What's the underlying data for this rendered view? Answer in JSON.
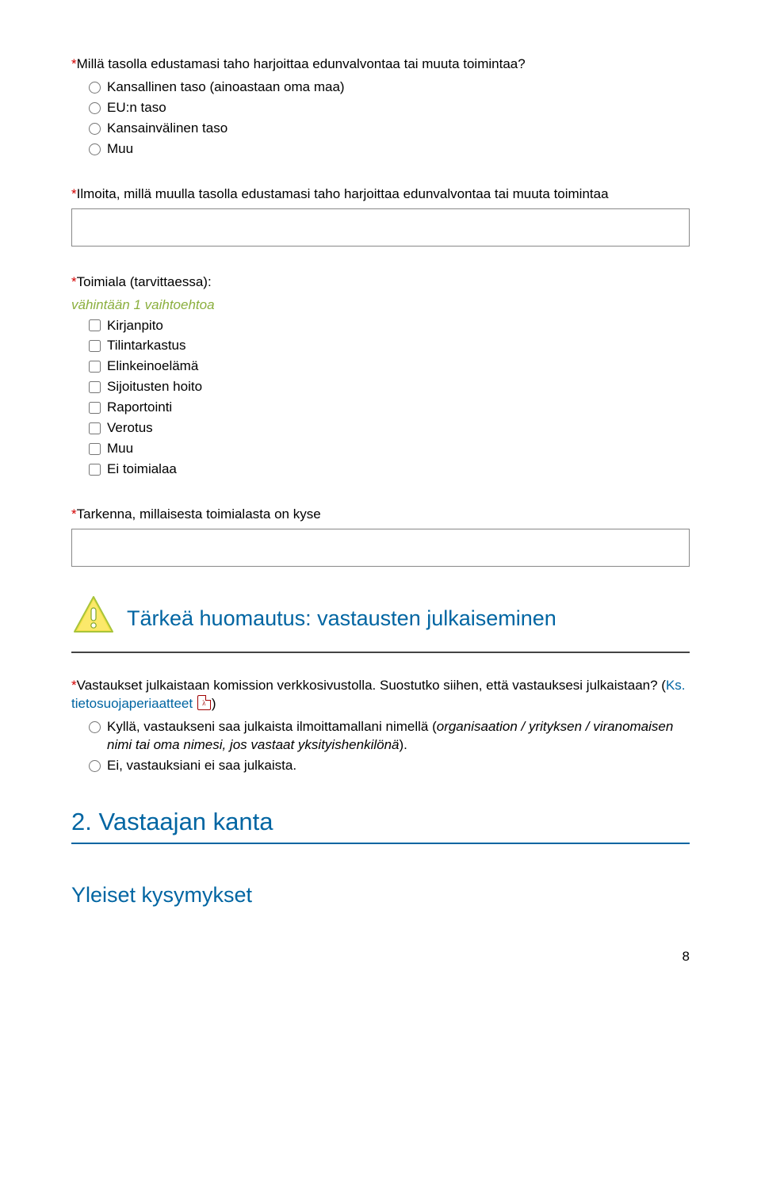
{
  "q1": {
    "label": "Millä tasolla edustamasi taho harjoittaa edunvalvontaa tai muuta toimintaa?",
    "options": [
      "Kansallinen taso (ainoastaan oma maa)",
      "EU:n taso",
      "Kansainvälinen taso",
      "Muu"
    ]
  },
  "q2": {
    "label": "Ilmoita, millä muulla tasolla edustamasi taho harjoittaa edunvalvontaa tai muuta toimintaa"
  },
  "q3": {
    "label": "Toimiala (tarvittaessa):",
    "hint": "vähintään 1 vaihtoehtoa",
    "options": [
      "Kirjanpito",
      "Tilintarkastus",
      "Elinkeinoelämä",
      "Sijoitusten hoito",
      "Raportointi",
      "Verotus",
      "Muu",
      "Ei toimialaa"
    ]
  },
  "q4": {
    "label": "Tarkenna, millaisesta toimialasta on kyse"
  },
  "alert": {
    "title": "Tärkeä huomautus: vastausten julkaiseminen"
  },
  "q5": {
    "part1": "Vastaukset julkaistaan komission verkkosivustolla. Suostutko siihen, että vastauksesi julkaistaan? (",
    "link_prefix": "Ks. ",
    "link_text": "tietosuojaperiaatteet",
    "part2": ")",
    "opt_yes_a": "Kyllä, vastaukseni saa julkaista ilmoittamallani nimellä (",
    "opt_yes_b": "organisaation / yrityksen / viranomaisen nimi tai oma nimesi, jos vastaat yksityishenkilönä",
    "opt_yes_c": ").",
    "opt_no": "Ei, vastauksiani ei saa julkaista."
  },
  "sec2": {
    "title": "2. Vastaajan kanta",
    "sub": "Yleiset kysymykset"
  },
  "page_number": "8"
}
